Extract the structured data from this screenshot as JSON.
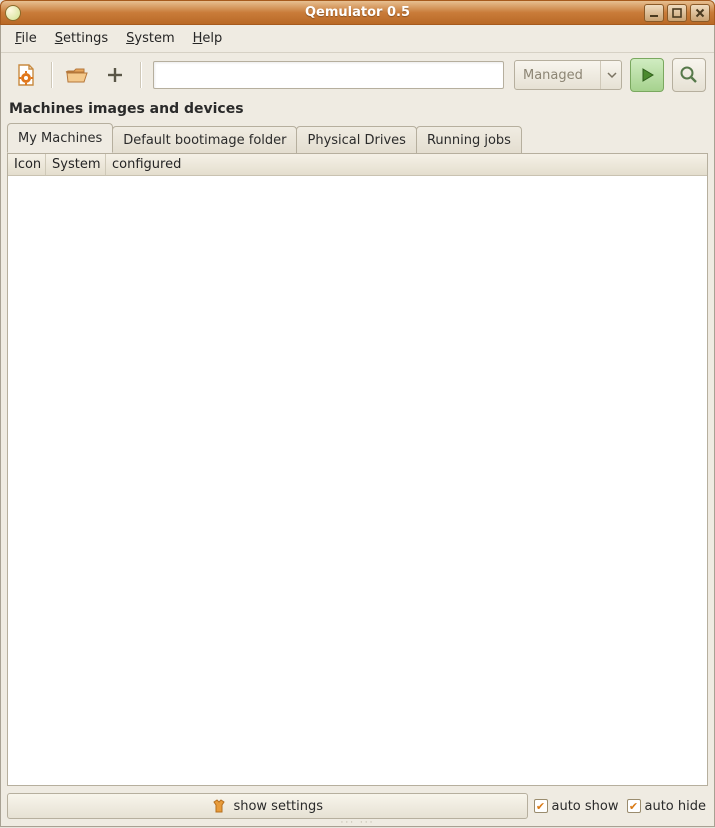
{
  "window": {
    "title": "Qemulator 0.5"
  },
  "menu": {
    "file": "File",
    "settings": "Settings",
    "system": "System",
    "help": "Help"
  },
  "toolbar": {
    "dropdown_label": "Managed",
    "search_value": ""
  },
  "section": {
    "heading": "Machines images and devices"
  },
  "tabs": [
    {
      "label": "My Machines",
      "active": true
    },
    {
      "label": "Default bootimage folder",
      "active": false
    },
    {
      "label": "Physical Drives",
      "active": false
    },
    {
      "label": "Running jobs",
      "active": false
    }
  ],
  "table": {
    "columns": [
      "Icon",
      "System",
      "configured"
    ],
    "rows": []
  },
  "bottom": {
    "show_settings": "show settings",
    "auto_show": "auto show",
    "auto_hide": "auto hide",
    "auto_show_checked": true,
    "auto_hide_checked": true
  }
}
